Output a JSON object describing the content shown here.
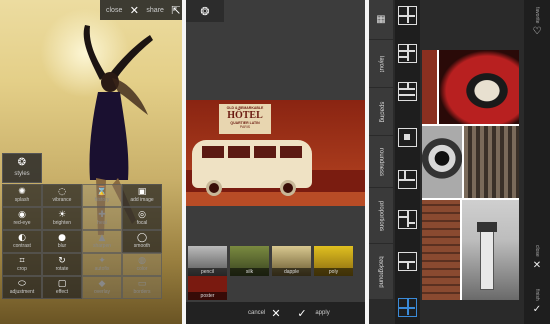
{
  "panel1": {
    "close_label": "close",
    "share_label": "share",
    "styles_label": "styles",
    "tools": [
      {
        "label": "splash",
        "icon": "splash-icon",
        "glyph": "✺"
      },
      {
        "label": "vibrance",
        "icon": "vibrance-icon",
        "glyph": "◌"
      },
      {
        "label": "history",
        "icon": "history-icon",
        "glyph": "⌛"
      },
      {
        "label": "add image",
        "icon": "add-image-icon",
        "glyph": "▣"
      },
      {
        "label": "red-eye",
        "icon": "red-eye-icon",
        "glyph": "◉"
      },
      {
        "label": "brighten",
        "icon": "brighten-icon",
        "glyph": "☀"
      },
      {
        "label": "heal",
        "icon": "heal-icon",
        "glyph": "✚"
      },
      {
        "label": "focal",
        "icon": "focal-icon",
        "glyph": "◎"
      },
      {
        "label": "contrast",
        "icon": "contrast-icon",
        "glyph": "◐"
      },
      {
        "label": "blur",
        "icon": "blur-icon",
        "glyph": "●"
      },
      {
        "label": "sharpen",
        "icon": "sharpen-icon",
        "glyph": "▲"
      },
      {
        "label": "smooth",
        "icon": "smooth-icon",
        "glyph": "◯"
      },
      {
        "label": "crop",
        "icon": "crop-icon",
        "glyph": "⌗"
      },
      {
        "label": "rotate",
        "icon": "rotate-icon",
        "glyph": "↻"
      },
      {
        "label": "autofix",
        "icon": "autofix-icon",
        "glyph": "✦"
      },
      {
        "label": "color",
        "icon": "color-icon",
        "glyph": "◍"
      },
      {
        "label": "adjustment",
        "icon": "adjustment-icon",
        "glyph": "⬭"
      },
      {
        "label": "effect",
        "icon": "effect-icon",
        "glyph": "▢"
      },
      {
        "label": "overlay",
        "icon": "overlay-icon",
        "glyph": "◆"
      },
      {
        "label": "borders",
        "icon": "borders-icon",
        "glyph": "▭"
      }
    ]
  },
  "panel2": {
    "sign_line1": "OLD & REMARKABLE",
    "sign_title": "HÔTEL",
    "sign_line2": "QUARTIER LATIN",
    "sign_line3": "PARIS",
    "filters": [
      {
        "label": "pencil"
      },
      {
        "label": "silk"
      },
      {
        "label": "dapple"
      },
      {
        "label": "poly"
      }
    ],
    "poster_label": "poster",
    "cancel_label": "cancel",
    "apply_label": "apply"
  },
  "panel3": {
    "tabs": [
      "layout",
      "spacing",
      "roundness",
      "proportions",
      "background"
    ],
    "favorite_label": "favorite",
    "close_label": "close",
    "finish_label": "finish"
  },
  "colors": {
    "photo_red": "#7a1c10",
    "van_cream": "#efe2c4",
    "toolbar_dark": "#222222"
  }
}
